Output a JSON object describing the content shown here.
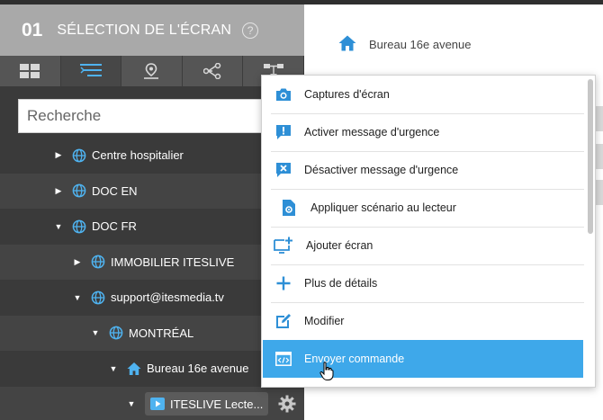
{
  "header": {
    "step": "01",
    "title": "SÉLECTION DE L'ÉCRAN",
    "help_glyph": "?"
  },
  "tabs": [
    {
      "icon": "grid-icon"
    },
    {
      "icon": "list-tree-icon",
      "active": true
    },
    {
      "icon": "map-pin-icon"
    },
    {
      "icon": "share-nodes-icon"
    },
    {
      "icon": "hierarchy-icon"
    }
  ],
  "search": {
    "placeholder": "Recherche",
    "value": ""
  },
  "tree": [
    {
      "label": "Centre hospitalier",
      "icon": "globe-icon",
      "expanded": false
    },
    {
      "label": "DOC EN",
      "icon": "globe-icon",
      "expanded": false
    },
    {
      "label": "DOC FR",
      "icon": "globe-icon",
      "expanded": true
    },
    {
      "label": "IMMOBILIER ITESLIVE",
      "icon": "globe-icon",
      "expanded": false
    },
    {
      "label": "support@itesmedia.tv",
      "icon": "globe-icon",
      "expanded": true
    },
    {
      "label": "MONTRÉAL",
      "icon": "globe-icon",
      "expanded": true
    },
    {
      "label": "Bureau 16e avenue",
      "icon": "home-icon",
      "expanded": true
    },
    {
      "label": "ITESLIVE Lecte...",
      "icon": "player-icon",
      "selected": true
    }
  ],
  "breadcrumb": {
    "label": "Bureau 16e avenue",
    "icon": "home-icon"
  },
  "context_menu": [
    {
      "label": "Captures d'écran",
      "icon": "camera-icon"
    },
    {
      "label": "Activer message d'urgence",
      "icon": "alert-message-icon"
    },
    {
      "label": "Désactiver message d'urgence",
      "icon": "cancel-message-icon"
    },
    {
      "label": "Appliquer scénario au lecteur",
      "icon": "file-gear-icon"
    },
    {
      "label": "Ajouter écran",
      "icon": "add-screen-icon"
    },
    {
      "label": "Plus de détails",
      "icon": "plus-icon"
    },
    {
      "label": "Modifier",
      "icon": "edit-icon"
    },
    {
      "label": "Envoyer commande",
      "icon": "code-window-icon",
      "highlighted": true
    }
  ],
  "colors": {
    "accent": "#3ea8ea",
    "icon_blue": "#2e8fd6",
    "header_bg": "#a9a9a9",
    "panel_bg": "#3a3a3a"
  }
}
